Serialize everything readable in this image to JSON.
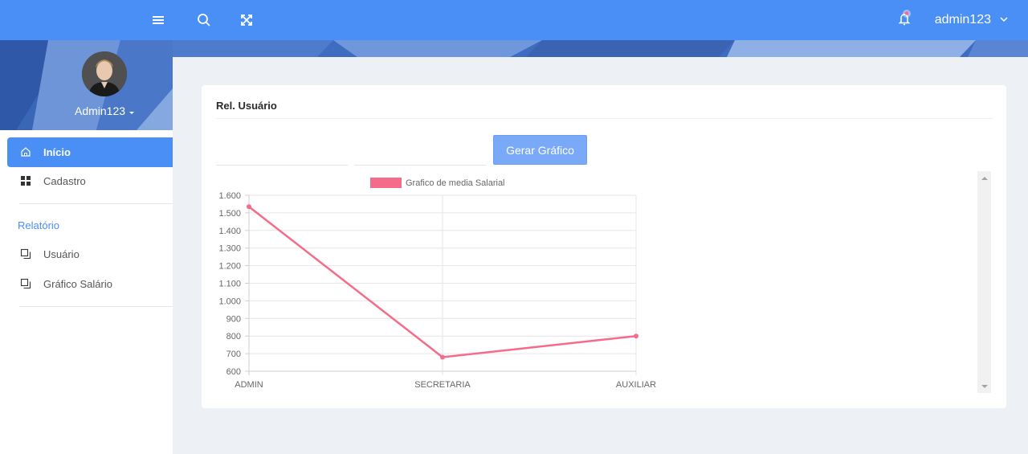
{
  "topbar": {
    "user_label": "admin123",
    "icons": [
      "menu-icon",
      "search-icon",
      "fullscreen-icon",
      "bell-icon",
      "chevron-down-icon"
    ],
    "color": "#4a8ff6"
  },
  "sidebar": {
    "profile_name": "Admin123",
    "items": [
      {
        "label": "Início",
        "icon": "home-icon",
        "active": true
      },
      {
        "label": "Cadastro",
        "icon": "grid-icon",
        "active": false
      }
    ],
    "section_title": "Relatório",
    "report_items": [
      {
        "label": "Usuário",
        "icon": "copy-icon"
      },
      {
        "label": "Gráfico Salário",
        "icon": "copy-icon"
      }
    ]
  },
  "card": {
    "title": "Rel. Usuário",
    "field1_value": "",
    "field2_value": "",
    "button_label": "Gerar Gráfico"
  },
  "chart_data": {
    "type": "line",
    "categories": [
      "ADMIN",
      "SECRETARIA",
      "AUXILIAR"
    ],
    "series": [
      {
        "name": "Grafico de media Salarial",
        "values": [
          1535,
          680,
          800
        ],
        "color": "#f56b8a"
      }
    ],
    "ylim": [
      600,
      1600
    ],
    "yticks": [
      "1.600",
      "1.500",
      "1.400",
      "1.300",
      "1.200",
      "1.100",
      "1.000",
      "900",
      "800",
      "700",
      "600"
    ],
    "grid": true,
    "legend": "top"
  }
}
